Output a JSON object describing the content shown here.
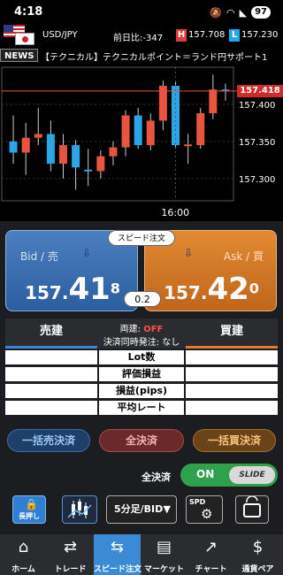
{
  "status": {
    "time": "4:18",
    "battery": "97"
  },
  "pair": {
    "symbol": "USD/JPY",
    "change_label": "前日比:",
    "change_value": "-347",
    "high_tag": "H",
    "high": "157.708",
    "low_tag": "L",
    "low": "157.230"
  },
  "news": {
    "tag": "NEWS",
    "headline": "【テクニカル】テクニカルポイント＝ランド円サポート1"
  },
  "chart": {
    "last_price": "157.418",
    "time_label": "16:00",
    "colors": {
      "up": "#e8543e",
      "down": "#29a6e8",
      "last": "#e8543e"
    }
  },
  "chart_data": {
    "type": "candlestick",
    "y_ticks": [
      "157.400",
      "157.350",
      "157.300"
    ],
    "ylim": [
      157.27,
      157.45
    ],
    "x_tick": "16:00",
    "candles": [
      {
        "o": 157.35,
        "c": 157.335,
        "h": 157.385,
        "l": 157.32
      },
      {
        "o": 157.335,
        "c": 157.355,
        "h": 157.375,
        "l": 157.305
      },
      {
        "o": 157.355,
        "c": 157.36,
        "h": 157.395,
        "l": 157.345
      },
      {
        "o": 157.36,
        "c": 157.32,
        "h": 157.378,
        "l": 157.31
      },
      {
        "o": 157.32,
        "c": 157.345,
        "h": 157.36,
        "l": 157.3
      },
      {
        "o": 157.345,
        "c": 157.315,
        "h": 157.352,
        "l": 157.285
      },
      {
        "o": 157.312,
        "c": 157.31,
        "h": 157.34,
        "l": 157.29
      },
      {
        "o": 157.31,
        "c": 157.33,
        "h": 157.338,
        "l": 157.3
      },
      {
        "o": 157.33,
        "c": 157.342,
        "h": 157.35,
        "l": 157.318
      },
      {
        "o": 157.342,
        "c": 157.385,
        "h": 157.392,
        "l": 157.33
      },
      {
        "o": 157.385,
        "c": 157.345,
        "h": 157.395,
        "l": 157.34
      },
      {
        "o": 157.345,
        "c": 157.378,
        "h": 157.388,
        "l": 157.338
      },
      {
        "o": 157.378,
        "c": 157.425,
        "h": 157.432,
        "l": 157.365
      },
      {
        "o": 157.425,
        "c": 157.345,
        "h": 157.43,
        "l": 157.34
      },
      {
        "o": 157.345,
        "c": 157.346,
        "h": 157.36,
        "l": 157.32
      },
      {
        "o": 157.345,
        "c": 157.388,
        "h": 157.395,
        "l": 157.34
      },
      {
        "o": 157.388,
        "c": 157.42,
        "h": 157.44,
        "l": 157.38
      },
      {
        "o": 157.42,
        "c": 157.418,
        "h": 157.428,
        "l": 157.405
      }
    ]
  },
  "quotes": {
    "speed_label": "スピード注文",
    "bid_label": "Bid / 売",
    "bid_small": "157.",
    "bid_big": "41",
    "bid_sup": "8",
    "ask_label": "Ask / 買",
    "ask_small": "157.",
    "ask_big": "42",
    "ask_sup": "0",
    "spread": "0.2"
  },
  "positions": {
    "sell_tab": "売建",
    "buy_tab": "買建",
    "hedge_label": "両建:",
    "hedge_value": "OFF",
    "settle_label": "決済同時発注: なし",
    "rows": [
      "Lot数",
      "評価損益",
      "損益(pips)",
      "平均レート"
    ]
  },
  "bulk": {
    "sell": "一括売決済",
    "all": "全決済",
    "buy": "一括買決済"
  },
  "toggle": {
    "label": "全決済",
    "state": "ON",
    "knob": "SLIDE"
  },
  "tools": {
    "hold": "長押し",
    "period": "5分足/BID",
    "spd": "SPD"
  },
  "nav": [
    {
      "label": "ホーム",
      "icon": "⌂"
    },
    {
      "label": "トレード",
      "icon": "⇄"
    },
    {
      "label": "スピード注文",
      "icon": "⇆"
    },
    {
      "label": "マーケット",
      "icon": "▤"
    },
    {
      "label": "チャート",
      "icon": "↗"
    },
    {
      "label": "通貨ペア",
      "icon": "$"
    }
  ]
}
